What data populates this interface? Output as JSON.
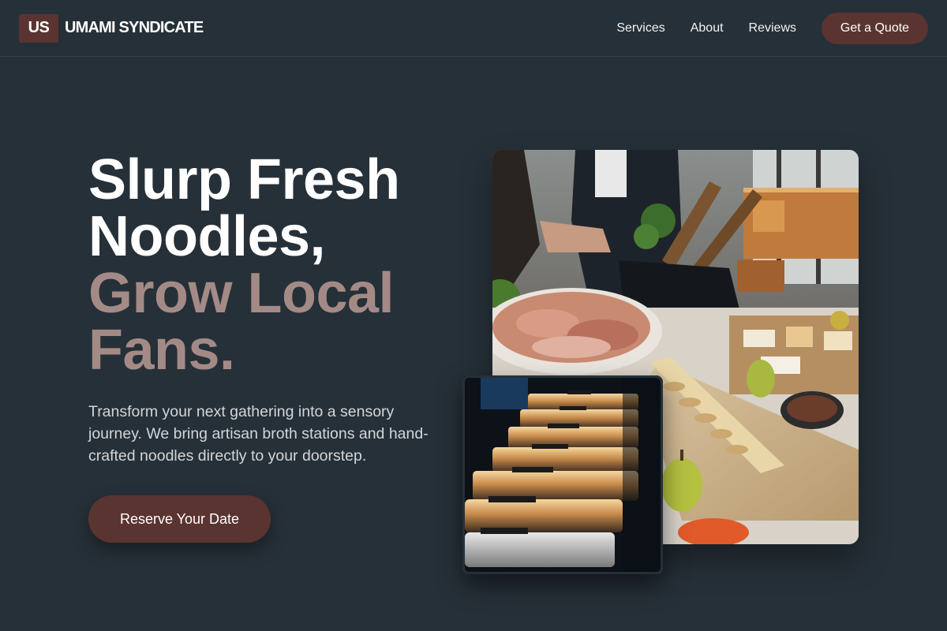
{
  "brand": {
    "logo_initials": "US",
    "name": "UMAMI SYNDICATE"
  },
  "nav": {
    "links": [
      "Services",
      "About",
      "Reviews"
    ],
    "cta_label": "Get a Quote"
  },
  "hero": {
    "headline_line1": "Slurp Fresh",
    "headline_line2": "Noodles,",
    "headline_accent_line1": "Grow Local",
    "headline_accent_line2": "Fans.",
    "subtitle": "Transform your next gathering into a sensory journey. We bring artisan broth stations and hand-crafted noodles directly to your doorstep.",
    "cta_label": "Reserve Your Date"
  },
  "colors": {
    "background": "#263038",
    "accent_brown": "#5a3430",
    "headline_accent": "#a48a86"
  }
}
